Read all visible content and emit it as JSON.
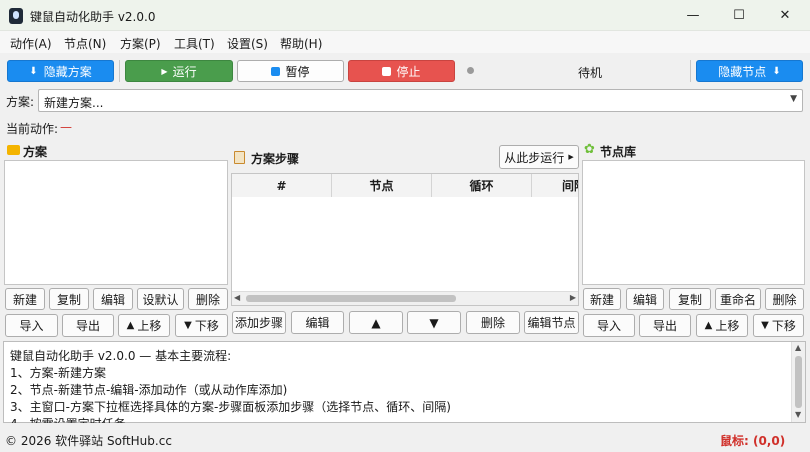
{
  "window": {
    "title": "键鼠自动化助手 v2.0.0",
    "controls": {
      "minimize": "—",
      "maximize": "☐",
      "close": "✕"
    }
  },
  "menu": [
    "动作(A)",
    "节点(N)",
    "方案(P)",
    "工具(T)",
    "设置(S)",
    "帮助(H)"
  ],
  "toolbar": {
    "hide_plan": "隐藏方案",
    "run": "运行",
    "pause": "暂停",
    "stop": "停止",
    "status": "待机",
    "hide_node": "隐藏节点"
  },
  "plan_row": {
    "label": "方案:",
    "selected": "新建方案..."
  },
  "current_action": {
    "label": "当前动作:",
    "value": "—"
  },
  "left_panel": {
    "title": "方案",
    "buttons_row1": [
      "新建",
      "复制",
      "编辑",
      "设默认",
      "删除"
    ],
    "buttons_row2": [
      "导入",
      "导出",
      "上移",
      "下移"
    ]
  },
  "middle_panel": {
    "title": "方案步骤",
    "run_from_step": "从此步运行",
    "columns": [
      "#",
      "节点",
      "循环",
      "间隔"
    ],
    "buttons": [
      "添加步骤",
      "编辑",
      "▲",
      "▼",
      "删除",
      "编辑节点"
    ]
  },
  "right_panel": {
    "title": "节点库",
    "buttons_row1": [
      "新建",
      "编辑",
      "复制",
      "重命名",
      "删除"
    ],
    "buttons_row2": [
      "导入",
      "导出",
      "上移",
      "下移"
    ]
  },
  "log_lines": [
    "键鼠自动化助手 v2.0.0 — 基本主要流程:",
    "1、方案-新建方案",
    "2、节点-新建节点-编辑-添加动作（或从动作库添加)",
    "3、主窗口-方案下拉框选择具体的方案-步骤面板添加步骤（选择节点、循环、间隔)",
    "4、按需设置定时任务"
  ],
  "status_bar": {
    "copyright": "© 2026 软件驿站 SoftHub.cc",
    "mouse": "鼠标: (0,0)"
  },
  "colors": {
    "accent_blue": "#1a8cf0",
    "run_green": "#4a9d4c",
    "stop_red": "#e7534f",
    "mouse_red": "#d0302a"
  }
}
